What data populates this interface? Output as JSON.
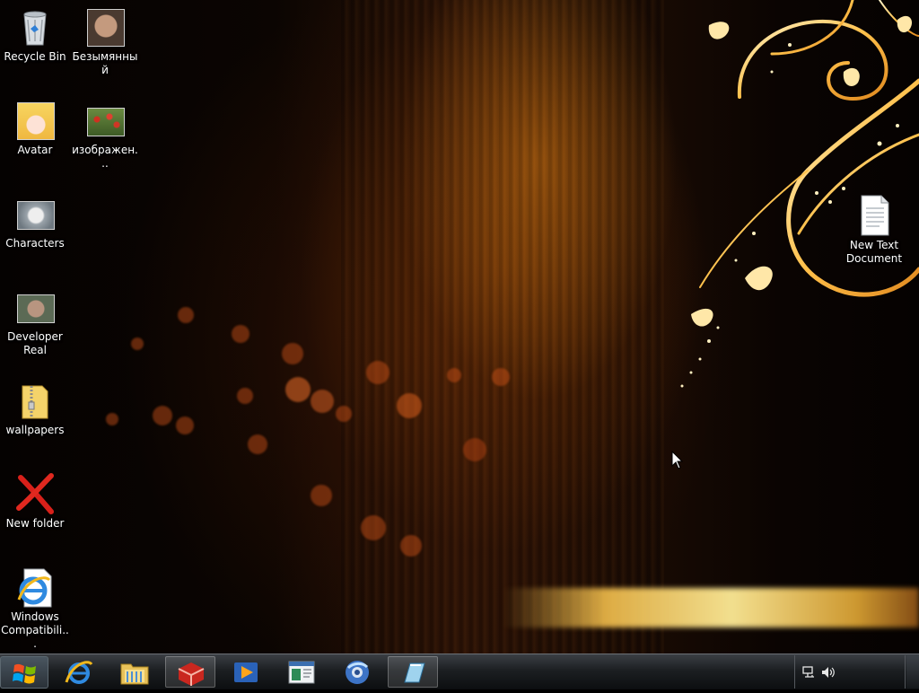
{
  "desktop": {
    "icons": [
      {
        "label": "Recycle Bin",
        "icon": "recycle-bin-icon"
      },
      {
        "label": "Безымянный",
        "icon": "photo-thumbnail-icon"
      },
      {
        "label": "Avatar",
        "icon": "anime-avatar-icon"
      },
      {
        "label": "изображен...",
        "icon": "flowers-image-icon"
      },
      {
        "label": "Characters",
        "icon": "characters-image-icon"
      },
      {
        "label": "Developer\nReal",
        "icon": "photo-thumbnail-icon"
      },
      {
        "label": "wallpapers",
        "icon": "zip-folder-icon"
      },
      {
        "label": "New folder",
        "icon": "red-x-icon"
      },
      {
        "label": "Windows\nCompatibili...",
        "icon": "internet-explorer-doc-icon"
      },
      {
        "label": "New Text\nDocument",
        "icon": "text-document-icon"
      }
    ]
  },
  "taskbar": {
    "start_icon": "windows-logo-icon",
    "buttons": [
      {
        "name": "internet-explorer",
        "icon": "internet-explorer-icon"
      },
      {
        "name": "windows-explorer",
        "icon": "folder-library-icon"
      },
      {
        "name": "red-app",
        "icon": "red-box-icon"
      },
      {
        "name": "media-player",
        "icon": "media-player-icon"
      },
      {
        "name": "control-panel",
        "icon": "window-app-icon"
      },
      {
        "name": "browser",
        "icon": "globe-browser-icon"
      },
      {
        "name": "notepad-app",
        "icon": "notebook-icon"
      }
    ],
    "tray": {
      "network_icon": "network-icon",
      "volume_icon": "speaker-icon"
    }
  },
  "colors": {
    "accent": "#ffb030",
    "taskbar": "#1c1f22"
  }
}
